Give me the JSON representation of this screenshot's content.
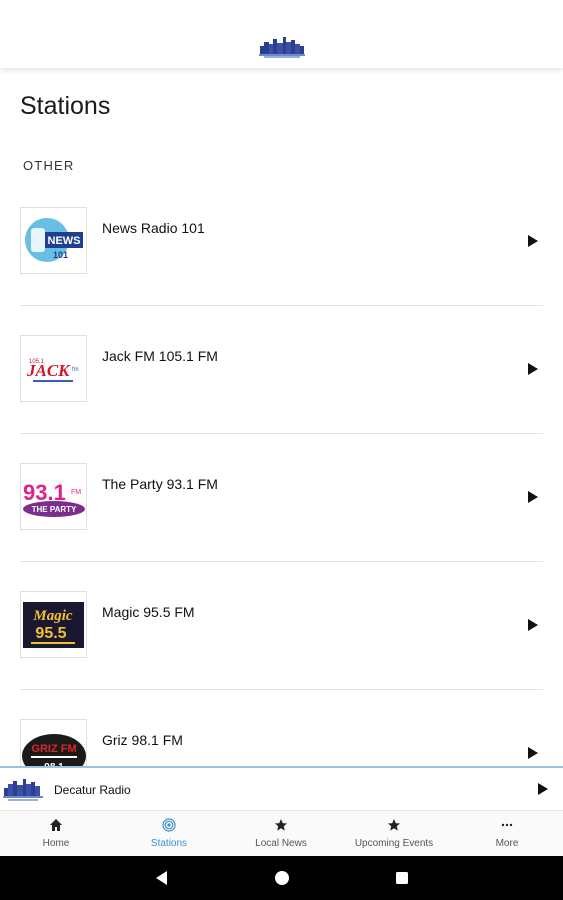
{
  "header": {
    "logo_icon": "decatur-radio-skyline-logo"
  },
  "page": {
    "title": "Stations",
    "section_label": "OTHER"
  },
  "stations": [
    {
      "name": "News Radio 101",
      "logo_text": "NEWS 101"
    },
    {
      "name": "Jack FM 105.1 FM",
      "logo_text": "JACK fm"
    },
    {
      "name": "The Party 93.1 FM",
      "logo_text": "93.1 FM THE PARTY"
    },
    {
      "name": "Magic 95.5 FM",
      "logo_text": "Magic 95.5"
    },
    {
      "name": "Griz 98.1 FM",
      "logo_text": "GRIZ FM"
    }
  ],
  "mini_player": {
    "title": "Decatur Radio",
    "play_icon": "play-icon"
  },
  "tabs": [
    {
      "label": "Home",
      "icon": "home-icon",
      "active": false
    },
    {
      "label": "Stations",
      "icon": "radio-waves-icon",
      "active": true
    },
    {
      "label": "Local News",
      "icon": "star-icon",
      "active": false
    },
    {
      "label": "Upcoming Events",
      "icon": "star-icon",
      "active": false
    },
    {
      "label": "More",
      "icon": "more-dots-icon",
      "active": false
    }
  ],
  "colors": {
    "accent": "#3b8fd1",
    "divider": "#e3e3e3",
    "player_border": "#9ec3e2"
  }
}
